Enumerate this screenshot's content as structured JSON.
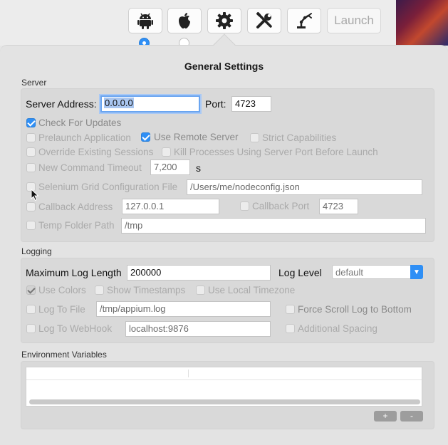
{
  "toolbar": {
    "buttons": [
      {
        "name": "android",
        "icon": "android-icon"
      },
      {
        "name": "apple",
        "icon": "apple-icon"
      },
      {
        "name": "settings",
        "icon": "gear-icon"
      },
      {
        "name": "developer",
        "icon": "tools-icon"
      },
      {
        "name": "robot",
        "icon": "robot-arm-icon"
      }
    ],
    "launch_label": "Launch",
    "platform_selected": "android"
  },
  "dialog": {
    "title": "General Settings"
  },
  "server": {
    "section_label": "Server",
    "address_label": "Server Address:",
    "address_value": "0.0.0.0",
    "port_label": "Port:",
    "port_value": "4723",
    "check_updates": {
      "label": "Check For Updates",
      "checked": true
    },
    "prelaunch": {
      "label": "Prelaunch Application",
      "checked": false
    },
    "remote_server": {
      "label": "Use Remote Server",
      "checked": true
    },
    "strict_caps": {
      "label": "Strict Capabilities",
      "checked": false
    },
    "override_sessions": {
      "label": "Override Existing Sessions",
      "checked": false
    },
    "kill_processes": {
      "label": "Kill Processes Using Server Port Before Launch",
      "checked": false
    },
    "new_cmd_timeout": {
      "label": "New Command Timeout",
      "checked": false,
      "value": "7,200",
      "unit": "s"
    },
    "selenium_grid": {
      "label": "Selenium Grid Configuration File",
      "checked": false,
      "value": "/Users/me/nodeconfig.json"
    },
    "callback_address": {
      "label": "Callback Address",
      "checked": false,
      "value": "127.0.0.1"
    },
    "callback_port": {
      "label": "Callback Port",
      "checked": false,
      "value": "4723"
    },
    "temp_folder": {
      "label": "Temp Folder Path",
      "checked": false,
      "value": "/tmp"
    }
  },
  "logging": {
    "section_label": "Logging",
    "max_length_label": "Maximum Log Length",
    "max_length_value": "200000",
    "log_level_label": "Log Level",
    "log_level_value": "default",
    "use_colors": {
      "label": "Use Colors",
      "checked": true
    },
    "show_timestamps": {
      "label": "Show Timestamps",
      "checked": false
    },
    "local_timezone": {
      "label": "Use Local Timezone",
      "checked": false
    },
    "log_to_file": {
      "label": "Log To File",
      "checked": false,
      "value": "/tmp/appium.log"
    },
    "force_scroll": {
      "label": "Force Scroll Log to Bottom",
      "checked": false
    },
    "log_to_webhook": {
      "label": "Log To WebHook",
      "checked": false,
      "value": "localhost:9876"
    },
    "additional_spacing": {
      "label": "Additional Spacing",
      "checked": false
    }
  },
  "env": {
    "section_label": "Environment Variables",
    "add_label": "+",
    "remove_label": "-"
  },
  "colors": {
    "accent": "#2f8ff5",
    "panel": "#e3e3e3",
    "section_box": "#d9d9d9"
  }
}
